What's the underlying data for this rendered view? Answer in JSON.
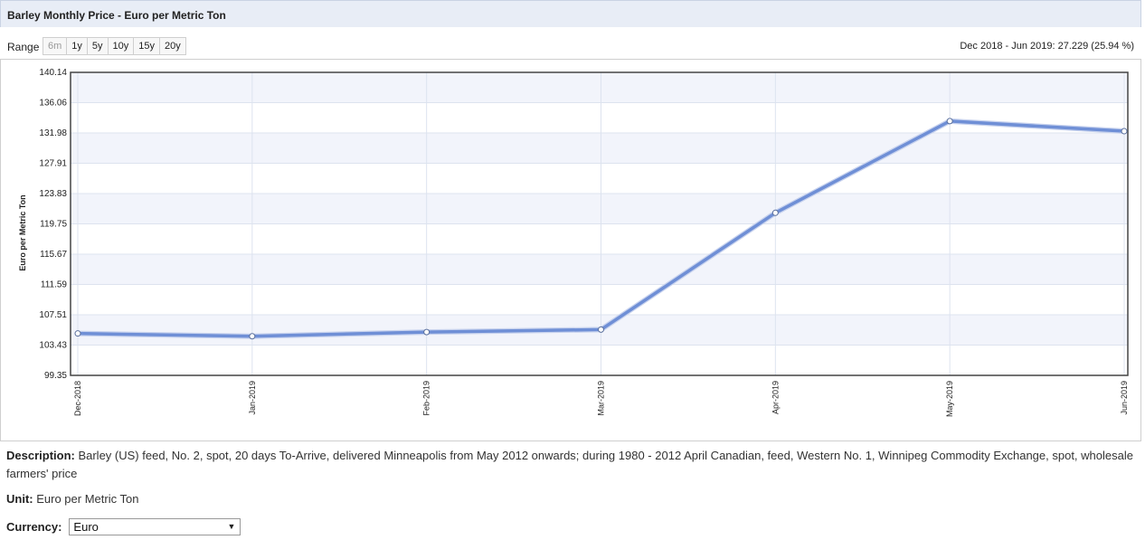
{
  "header": {
    "title": "Barley Monthly Price - Euro per Metric Ton"
  },
  "range": {
    "label": "Range",
    "buttons": [
      {
        "label": "6m",
        "enabled": false
      },
      {
        "label": "1y",
        "enabled": true
      },
      {
        "label": "5y",
        "enabled": true
      },
      {
        "label": "10y",
        "enabled": true
      },
      {
        "label": "15y",
        "enabled": true
      },
      {
        "label": "20y",
        "enabled": true
      }
    ],
    "summary": "Dec 2018 - Jun 2019: 27.229 (25.94 %)"
  },
  "chart_data": {
    "type": "line",
    "ylabel": "Euro per Metric Ton",
    "xlabel": "",
    "categories": [
      "Dec-2018",
      "Jan-2019",
      "Feb-2019",
      "Mar-2019",
      "Apr-2019",
      "May-2019",
      "Jun-2019"
    ],
    "series": [
      {
        "values": [
          104.99,
          104.62,
          105.18,
          105.51,
          121.23,
          133.58,
          132.22
        ]
      }
    ],
    "ylim": [
      99.35,
      140.14
    ],
    "yticks": [
      "140.14",
      "136.06",
      "131.98",
      "127.91",
      "123.83",
      "119.75",
      "115.67",
      "111.59",
      "107.51",
      "103.43",
      "99.35"
    ],
    "grid": true,
    "line_color": "#6f8fd6",
    "band_color": "#f2f4fb"
  },
  "description": {
    "label": "Description:",
    "text": " Barley (US) feed, No. 2, spot, 20 days To-Arrive, delivered Minneapolis from May 2012 onwards; during 1980 - 2012 April Canadian, feed, Western No. 1, Winnipeg Commodity Exchange, spot, wholesale farmers' price"
  },
  "unit": {
    "label": "Unit:",
    "value": " Euro per Metric Ton"
  },
  "currency": {
    "label": "Currency:",
    "selected": "Euro",
    "arrow": "▼"
  }
}
